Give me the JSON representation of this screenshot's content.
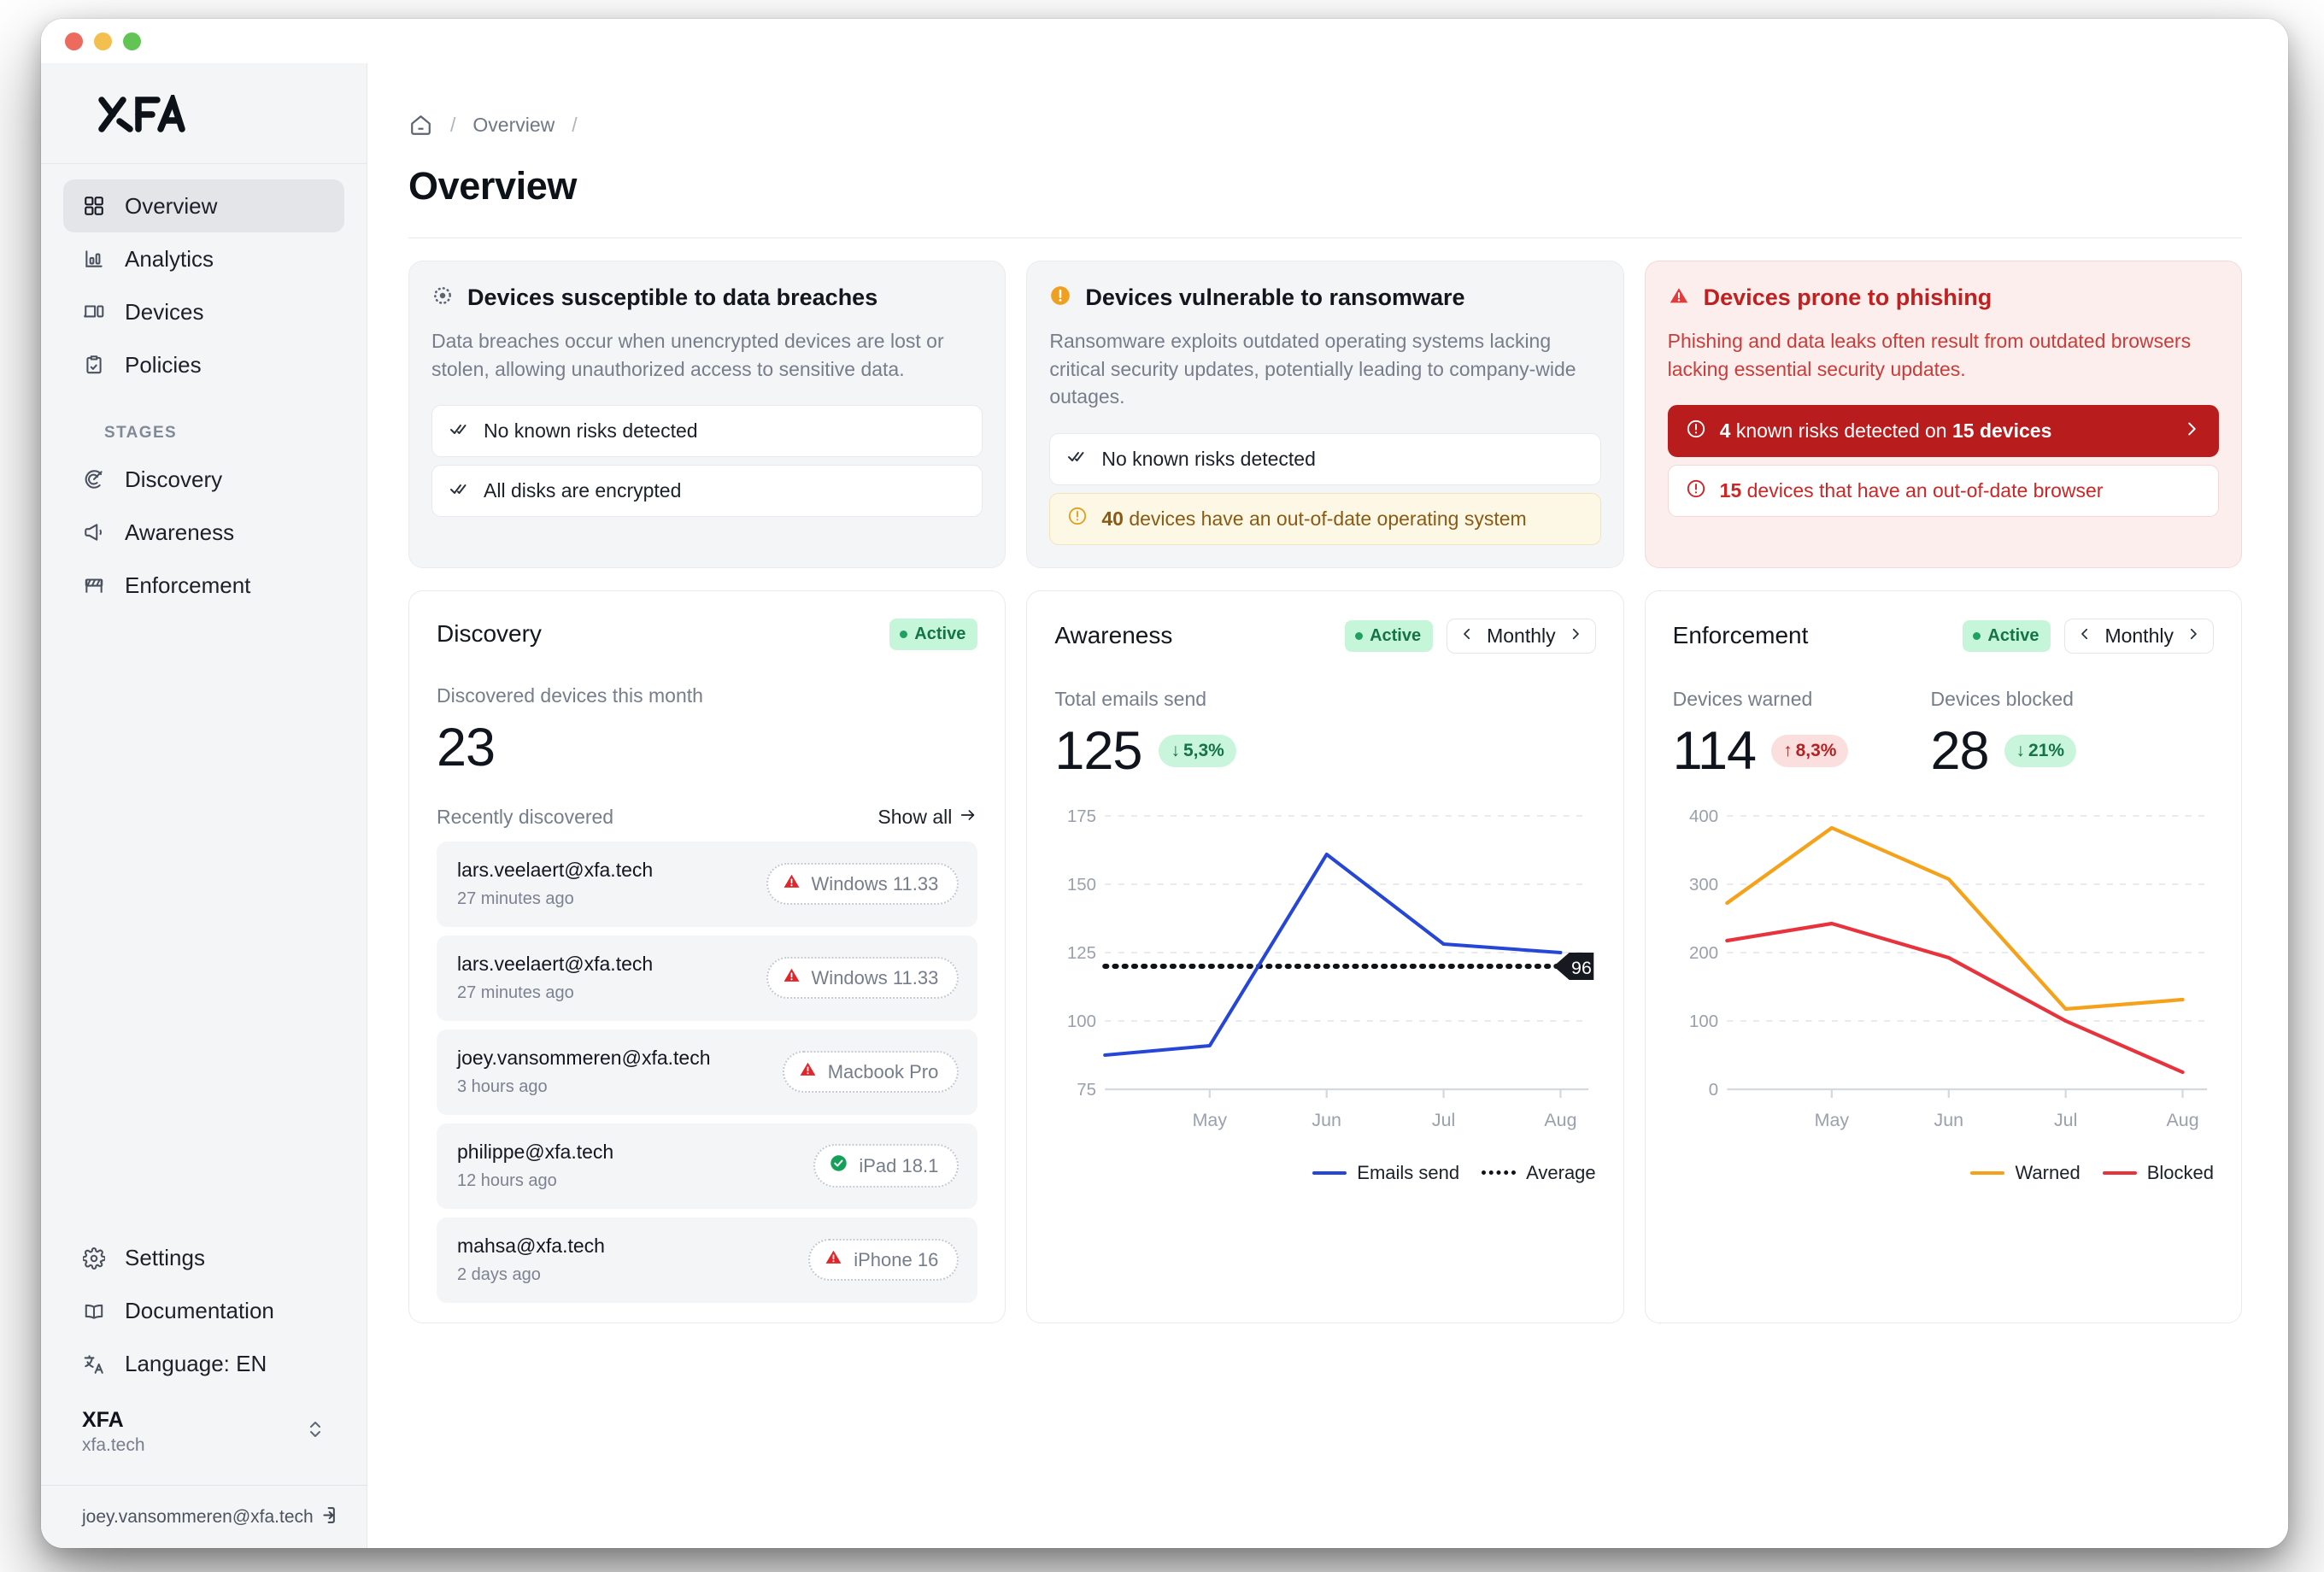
{
  "window": {
    "traffic_lights": [
      "close",
      "minimize",
      "zoom"
    ]
  },
  "sidebar": {
    "brand": "XFA",
    "nav": [
      {
        "label": "Overview",
        "icon": "grid-icon",
        "active": true
      },
      {
        "label": "Analytics",
        "icon": "bar-chart-icon",
        "active": false
      },
      {
        "label": "Devices",
        "icon": "laptop-icon",
        "active": false
      },
      {
        "label": "Policies",
        "icon": "clipboard-check-icon",
        "active": false
      }
    ],
    "section_label": "STAGES",
    "stages": [
      {
        "label": "Discovery",
        "icon": "radar-icon"
      },
      {
        "label": "Awareness",
        "icon": "megaphone-icon"
      },
      {
        "label": "Enforcement",
        "icon": "barrier-icon"
      }
    ],
    "utility": [
      {
        "label": "Settings",
        "icon": "gear-icon"
      },
      {
        "label": "Documentation",
        "icon": "book-icon"
      },
      {
        "label": "Language: EN",
        "icon": "translate-icon"
      }
    ],
    "org": {
      "name": "XFA",
      "domain": "xfa.tech"
    },
    "user": {
      "email": "joey.vansommeren@xfa.tech"
    }
  },
  "breadcrumb": {
    "home": "home-icon",
    "sep1": "/",
    "item": "Overview",
    "sep2": "/"
  },
  "page": {
    "title": "Overview"
  },
  "risk_cards": [
    {
      "title": "Devices susceptible to data breaches",
      "icon": "scan-dotted-icon",
      "description": "Data breaches occur when unencrypted devices are lost or stolen, allowing unauthorized access to sensitive data.",
      "rows": [
        {
          "style": "ok",
          "icon": "double-check-icon",
          "text": "No known risks detected"
        },
        {
          "style": "ok",
          "icon": "double-check-icon",
          "text": "All disks are encrypted"
        }
      ]
    },
    {
      "title": "Devices vulnerable to ransomware",
      "icon": "alert-circle-filled-icon",
      "description": "Ransomware exploits outdated operating systems lacking critical security updates, potentially leading to company-wide outages.",
      "rows": [
        {
          "style": "ok",
          "icon": "double-check-icon",
          "text": "No known risks detected"
        },
        {
          "style": "warn",
          "icon": "alert-circle-icon",
          "count": "40",
          "text": "devices have an out-of-date operating system"
        }
      ]
    },
    {
      "title": "Devices prone to phishing",
      "icon": "warning-triangle-icon",
      "description": "Phishing and data leaks often result from outdated browsers lacking essential security updates.",
      "danger": true,
      "rows": [
        {
          "style": "crit",
          "icon": "alert-circle-icon",
          "count": "4",
          "text": "known risks detected on",
          "count2": "15 devices",
          "chevron": "chevron-right-icon"
        },
        {
          "style": "soft",
          "icon": "alert-circle-icon",
          "count": "15",
          "text": "devices that have an out-of-date browser"
        }
      ]
    }
  ],
  "discovery": {
    "title": "Discovery",
    "status": "Active",
    "metric_label": "Discovered devices this month",
    "metric_value": "23",
    "recent_label": "Recently discovered",
    "show_all": "Show all",
    "show_all_icon": "arrow-right-icon",
    "devices": [
      {
        "email": "lars.veelaert@xfa.tech",
        "time": "27 minutes ago",
        "tag": "Windows 11.33",
        "state": "warning"
      },
      {
        "email": "lars.veelaert@xfa.tech",
        "time": "27 minutes ago",
        "tag": "Windows 11.33",
        "state": "warning"
      },
      {
        "email": "joey.vansommeren@xfa.tech",
        "time": "3 hours ago",
        "tag": "Macbook Pro",
        "state": "warning"
      },
      {
        "email": "philippe@xfa.tech",
        "time": "12 hours ago",
        "tag": "iPad 18.1",
        "state": "ok"
      },
      {
        "email": "mahsa@xfa.tech",
        "time": "2 days ago",
        "tag": "iPhone 16",
        "state": "warning"
      }
    ]
  },
  "awareness": {
    "title": "Awareness",
    "status": "Active",
    "period": "Monthly",
    "prev_icon": "chevron-left-icon",
    "next_icon": "chevron-right-icon",
    "metric_label": "Total emails send",
    "metric_value": "125",
    "delta": "5,3%",
    "delta_dir": "down",
    "delta_tone": "good"
  },
  "enforcement": {
    "title": "Enforcement",
    "status": "Active",
    "period": "Monthly",
    "prev_icon": "chevron-left-icon",
    "next_icon": "chevron-right-icon",
    "metrics": [
      {
        "label": "Devices warned",
        "value": "114",
        "delta": "8,3%",
        "delta_dir": "up",
        "delta_tone": "bad"
      },
      {
        "label": "Devices blocked",
        "value": "28",
        "delta": "21%",
        "delta_dir": "down",
        "delta_tone": "good"
      }
    ]
  },
  "colors": {
    "emails_line": "#2546d6",
    "average_line": "#101419",
    "warned_line": "#f5a11a",
    "blocked_line": "#e8323c",
    "danger": "#b81c1c",
    "warning": "#e8a020",
    "success": "#157347"
  },
  "chart_data": [
    {
      "type": "line",
      "id": "awareness-chart",
      "title": "Total emails send",
      "categories": [
        "May",
        "Jun",
        "Jul",
        "Aug"
      ],
      "ylim": [
        75,
        175
      ],
      "yticks": [
        75,
        100,
        125,
        150,
        175
      ],
      "grid": true,
      "legend_position": "bottom-right",
      "annotation": {
        "label": "96",
        "at": "Aug",
        "on": "Average"
      },
      "series": [
        {
          "name": "Emails send",
          "color": "#2546d6",
          "style": "solid",
          "values": [
            91,
            161,
            128,
            125
          ]
        },
        {
          "name": "Average",
          "color": "#101419",
          "style": "dotted",
          "values": [
            120,
            120,
            120,
            120
          ]
        }
      ]
    },
    {
      "type": "line",
      "id": "enforcement-chart",
      "title": "Devices warned / blocked",
      "categories": [
        "May",
        "Jun",
        "Jul",
        "Aug"
      ],
      "ylim": [
        0,
        400
      ],
      "yticks": [
        0,
        100,
        200,
        300,
        400
      ],
      "grid": true,
      "legend_position": "bottom-right",
      "series": [
        {
          "name": "Warned",
          "color": "#f5a11a",
          "style": "solid",
          "lead_in": 273,
          "values": [
            383,
            307,
            118,
            131
          ]
        },
        {
          "name": "Blocked",
          "color": "#e8323c",
          "style": "solid",
          "lead_in": 218,
          "values": [
            243,
            192,
            100,
            25
          ]
        }
      ]
    }
  ]
}
